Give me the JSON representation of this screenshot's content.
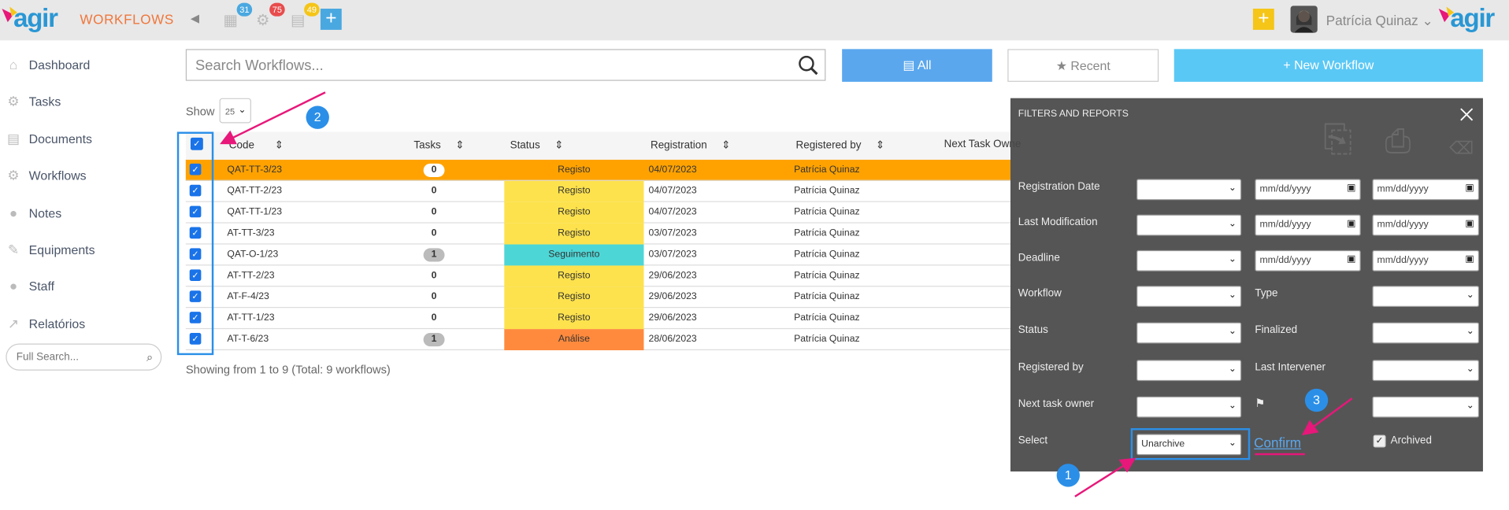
{
  "header": {
    "logo_text": "agir",
    "app_name": "WORKFLOWS",
    "badges": {
      "calendar": "31",
      "workflow": "75",
      "docs": "49"
    },
    "user_name": "Patrícia Quinaz",
    "plus_label": "+"
  },
  "sidebar": {
    "items": [
      {
        "label": "Dashboard",
        "icon": "home-icon"
      },
      {
        "label": "Tasks",
        "icon": "gear-icon"
      },
      {
        "label": "Documents",
        "icon": "document-icon"
      },
      {
        "label": "Workflows",
        "icon": "gears-icon"
      },
      {
        "label": "Notes",
        "icon": "comments-icon"
      },
      {
        "label": "Equipments",
        "icon": "wrench-icon"
      },
      {
        "label": "Staff",
        "icon": "user-icon"
      },
      {
        "label": "Relatórios",
        "icon": "chart-icon"
      }
    ],
    "full_search_placeholder": "Full Search..."
  },
  "toolbar": {
    "search_placeholder": "Search Workflows...",
    "all_label": "All",
    "recent_label": "Recent",
    "new_label": "New Workflow"
  },
  "table": {
    "show_label": "Show",
    "page_size": "25",
    "columns": [
      "Code",
      "Tasks",
      "Status",
      "Registration",
      "Registered by",
      "Next Task Owne"
    ],
    "rows": [
      {
        "code": "QAT-TT-3/23",
        "tasks": "0",
        "status": "Registo",
        "date": "04/07/2023",
        "by": "Patrícia Quinaz"
      },
      {
        "code": "QAT-TT-2/23",
        "tasks": "0",
        "status": "Registo",
        "date": "04/07/2023",
        "by": "Patrícia Quinaz"
      },
      {
        "code": "QAT-TT-1/23",
        "tasks": "0",
        "status": "Registo",
        "date": "04/07/2023",
        "by": "Patrícia Quinaz"
      },
      {
        "code": "AT-TT-3/23",
        "tasks": "0",
        "status": "Registo",
        "date": "03/07/2023",
        "by": "Patrícia Quinaz"
      },
      {
        "code": "QAT-O-1/23",
        "tasks": "1",
        "status": "Seguimento",
        "date": "03/07/2023",
        "by": "Patrícia Quinaz"
      },
      {
        "code": "AT-TT-2/23",
        "tasks": "0",
        "status": "Registo",
        "date": "29/06/2023",
        "by": "Patrícia Quinaz"
      },
      {
        "code": "AT-F-4/23",
        "tasks": "0",
        "status": "Registo",
        "date": "29/06/2023",
        "by": "Patrícia Quinaz"
      },
      {
        "code": "AT-TT-1/23",
        "tasks": "0",
        "status": "Registo",
        "date": "29/06/2023",
        "by": "Patrícia Quinaz"
      },
      {
        "code": "AT-T-6/23",
        "tasks": "1",
        "status": "Análise",
        "date": "28/06/2023",
        "by": "Patrícia Quinaz"
      }
    ],
    "footer": "Showing from 1 to 9 (Total: 9 workflows)"
  },
  "filters": {
    "title": "FILTERS AND REPORTS",
    "registration_date": "Registration Date",
    "last_modification": "Last Modification",
    "deadline": "Deadline",
    "workflow": "Workflow",
    "type": "Type",
    "status": "Status",
    "finalized": "Finalized",
    "registered_by": "Registered by",
    "last_intervener": "Last Intervener",
    "next_task_owner": "Next task owner",
    "select": "Select",
    "select_value": "Unarchive",
    "confirm": "Confirm",
    "archived": "Archived",
    "date_placeholder": "mm/dd/yyyy"
  },
  "annotations": {
    "one": "1",
    "two": "2",
    "three": "3"
  },
  "colors": {
    "orange_row": "#ffa200",
    "registo": "#fde24d",
    "seguimento": "#4dd6d6",
    "analise": "#ff8a3d",
    "all_button": "#5aa7ee",
    "new_button": "#5ac8f5",
    "annotation_blue": "#2b8fe8",
    "arrow_pink": "#e8177a"
  }
}
